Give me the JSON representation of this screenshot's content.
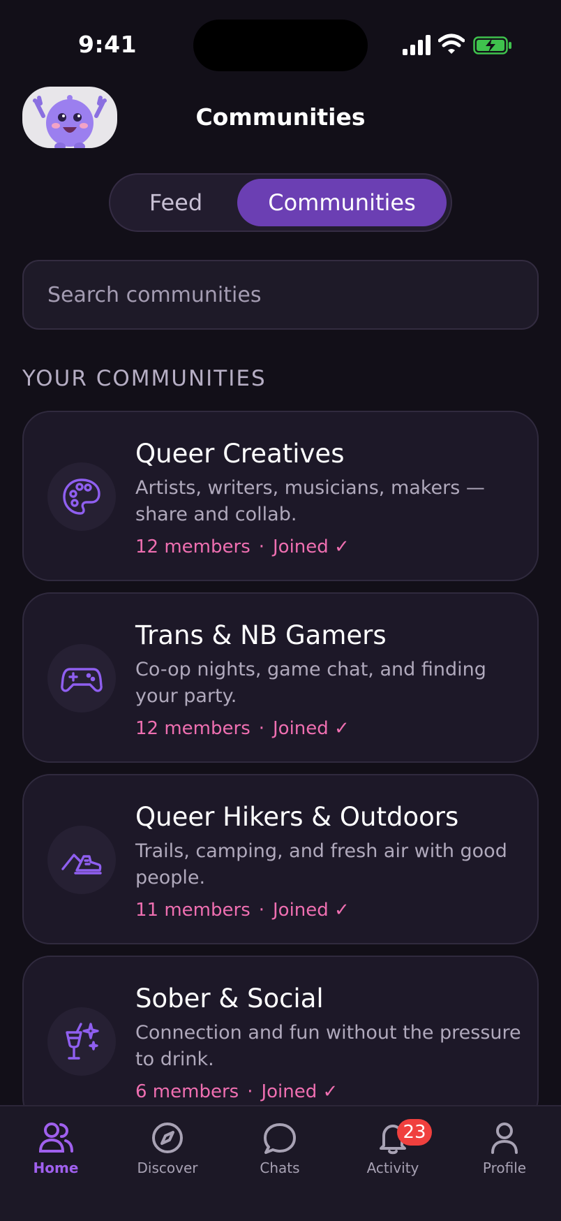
{
  "status_bar": {
    "time": "9:41"
  },
  "header": {
    "title": "Communities"
  },
  "segment": {
    "feed_label": "Feed",
    "communities_label": "Communities",
    "selected": "Communities"
  },
  "search": {
    "placeholder": "Search communities"
  },
  "section": {
    "title": "YOUR COMMUNITIES"
  },
  "communities": [
    {
      "name": "Queer Creatives",
      "description": "Artists, writers, musicians, makers — share and collab.",
      "members": "12 members",
      "status": "Joined ✓",
      "icon": "palette-icon"
    },
    {
      "name": "Trans & NB Gamers",
      "description": "Co-op nights, game chat, and finding your party.",
      "members": "12 members",
      "status": "Joined ✓",
      "icon": "gamepad-icon"
    },
    {
      "name": "Queer Hikers & Outdoors",
      "description": "Trails, camping, and fresh air with good people.",
      "members": "11 members",
      "status": "Joined ✓",
      "icon": "hiking-boot-icon"
    },
    {
      "name": "Sober & Social",
      "description": "Connection and fun without the pressure to drink.",
      "members": "6 members",
      "status": "Joined ✓",
      "icon": "mocktail-sparkle-icon"
    }
  ],
  "meta_separator": "·",
  "tabbar": {
    "items": [
      {
        "label": "Home",
        "icon": "users-icon",
        "active": true
      },
      {
        "label": "Discover",
        "icon": "compass-icon"
      },
      {
        "label": "Chats",
        "icon": "chat-bubble-icon"
      },
      {
        "label": "Activity",
        "icon": "bell-icon",
        "badge": "23"
      },
      {
        "label": "Profile",
        "icon": "person-icon"
      }
    ]
  },
  "colors": {
    "accent": "#6b3fb3",
    "accent_text": "#a060ee",
    "meta_pink": "#ef6fb1",
    "badge_red": "#f0403e",
    "background": "#120f18"
  }
}
